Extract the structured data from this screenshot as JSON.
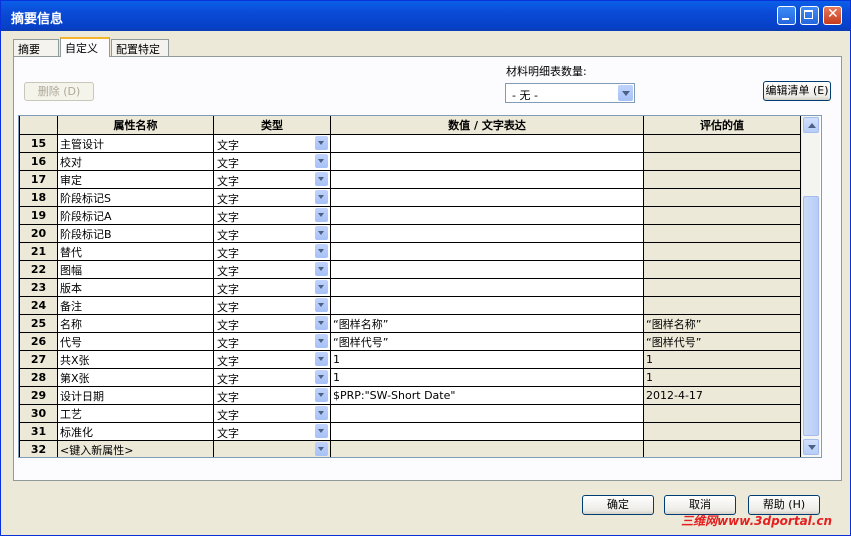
{
  "window": {
    "title": "摘要信息"
  },
  "tabs": [
    {
      "label": "摘要"
    },
    {
      "label": "自定义"
    },
    {
      "label": "配置特定"
    }
  ],
  "toolbar": {
    "delete_label": "删除 (D)",
    "bom_qty_label": "材料明细表数量:",
    "bom_qty_value": "- 无 -",
    "edit_list_label": "编辑清单 (E)"
  },
  "table": {
    "headers": [
      "属性名称",
      "类型",
      "数值 / 文字表达",
      "评估的值"
    ],
    "rows": [
      {
        "num": "15",
        "name": "主管设计",
        "type": "文字",
        "value": "",
        "eval": ""
      },
      {
        "num": "16",
        "name": "校对",
        "type": "文字",
        "value": "",
        "eval": ""
      },
      {
        "num": "17",
        "name": "审定",
        "type": "文字",
        "value": "",
        "eval": ""
      },
      {
        "num": "18",
        "name": "阶段标记S",
        "type": "文字",
        "value": "",
        "eval": ""
      },
      {
        "num": "19",
        "name": "阶段标记A",
        "type": "文字",
        "value": "",
        "eval": ""
      },
      {
        "num": "20",
        "name": "阶段标记B",
        "type": "文字",
        "value": "",
        "eval": ""
      },
      {
        "num": "21",
        "name": "替代",
        "type": "文字",
        "value": "",
        "eval": ""
      },
      {
        "num": "22",
        "name": "图幅",
        "type": "文字",
        "value": "",
        "eval": ""
      },
      {
        "num": "23",
        "name": "版本",
        "type": "文字",
        "value": "",
        "eval": ""
      },
      {
        "num": "24",
        "name": "备注",
        "type": "文字",
        "value": "",
        "eval": ""
      },
      {
        "num": "25",
        "name": "名称",
        "type": "文字",
        "value": "“图样名称”",
        "eval": "“图样名称”"
      },
      {
        "num": "26",
        "name": "代号",
        "type": "文字",
        "value": "“图样代号”",
        "eval": "“图样代号”"
      },
      {
        "num": "27",
        "name": "共X张",
        "type": "文字",
        "value": "1",
        "eval": "1"
      },
      {
        "num": "28",
        "name": "第X张",
        "type": "文字",
        "value": "1",
        "eval": "1"
      },
      {
        "num": "29",
        "name": "设计日期",
        "type": "文字",
        "value": "$PRP:\"SW-Short Date\"",
        "eval": "2012-4-17"
      },
      {
        "num": "30",
        "name": "工艺",
        "type": "文字",
        "value": "",
        "eval": ""
      },
      {
        "num": "31",
        "name": "标准化",
        "type": "文字",
        "value": "",
        "eval": ""
      },
      {
        "num": "32",
        "name": "<键入新属性>",
        "type": "",
        "value": "",
        "eval": ""
      }
    ]
  },
  "footer": {
    "ok_label": "确定",
    "cancel_label": "取消",
    "help_label": "帮助 (H)"
  },
  "watermark": "三维网www.3dportal.cn"
}
